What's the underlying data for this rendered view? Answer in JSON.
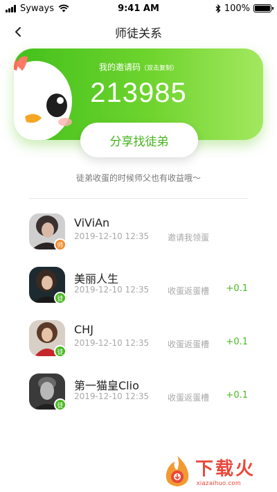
{
  "status_bar": {
    "carrier": "Syways",
    "time": "9:41 AM",
    "battery": "100%",
    "battery_level": 1.0
  },
  "nav": {
    "title": "师徒关系"
  },
  "invite_card": {
    "label": "我的邀请码",
    "sub_label": "（双击复制）",
    "code": "213985",
    "colors": {
      "start": "#43c01c",
      "end": "#a3e85f"
    }
  },
  "share_button": {
    "label": "分享找徒弟",
    "color": "#44b51a"
  },
  "tip": "徒弟收蛋的时候师父也有收益哦～",
  "relations": [
    {
      "name": "ViViAn",
      "time": "2019-12-10 12:35",
      "action": "邀请我领蛋",
      "reward": "",
      "badge": "师",
      "badge_type": "master"
    },
    {
      "name": "美丽人生",
      "time": "2019-12-10 12:35",
      "action": "收蛋返蛋槽",
      "reward": "+0.1",
      "badge": "徒",
      "badge_type": "disciple"
    },
    {
      "name": "CHJ",
      "time": "2019-12-10 12:35",
      "action": "收蛋返蛋槽",
      "reward": "+0.1",
      "badge": "徒",
      "badge_type": "disciple"
    },
    {
      "name": "第一猫皇Clio",
      "time": "2019-12-10 12:35",
      "action": "收蛋返蛋槽",
      "reward": "+0.1",
      "badge": "徒",
      "badge_type": "disciple"
    }
  ],
  "watermark": {
    "text": "下载火",
    "url": "xiazaihuo.com"
  },
  "icons": {
    "back": "chevron-left-icon",
    "wifi": "wifi-icon",
    "bluetooth": "bluetooth-icon",
    "battery": "battery-icon",
    "signal": "signal-icon",
    "mascot": "chick-mascot-icon"
  }
}
